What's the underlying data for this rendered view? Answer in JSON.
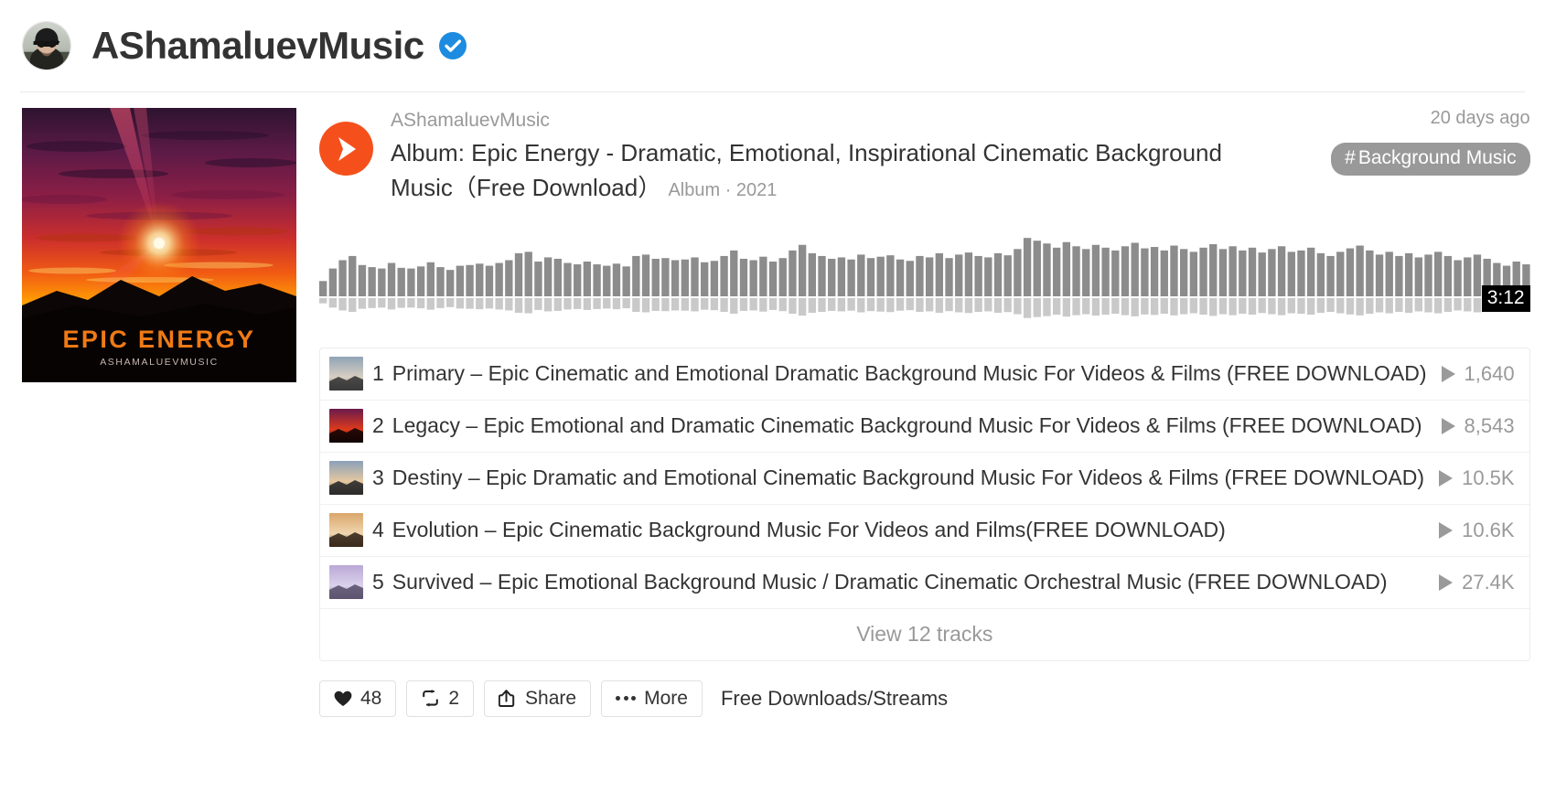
{
  "header": {
    "username": "AShamaluevMusic",
    "verified_icon": "verified-badge-icon",
    "avatar_icon": "user-avatar"
  },
  "artwork": {
    "album_title": "EPIC ENERGY",
    "album_artist": "ASHAMALUEVMUSIC"
  },
  "track": {
    "uploader": "AShamaluevMusic",
    "title": "Album: Epic Energy - Dramatic, Emotional, Inspirational Cinematic Background Music（Free Download）",
    "subtitle": "Album · 2021",
    "posted": "20 days ago",
    "tag": "Background Music",
    "tag_hash": "#",
    "duration": "3:12",
    "play_icon": "play-icon"
  },
  "tracklist": {
    "view_all_label": "View 12 tracks",
    "tracks": [
      {
        "index": "1",
        "title": "Primary – Epic Cinematic and Emotional Dramatic Background Music For Videos & Films (FREE DOWNLOAD)",
        "plays": "1,640"
      },
      {
        "index": "2",
        "title": "Legacy – Epic Emotional and Dramatic Cinematic Background Music For Videos & Films (FREE DOWNLOAD)",
        "plays": "8,543"
      },
      {
        "index": "3",
        "title": "Destiny – Epic Dramatic and Emotional Cinematic Background Music For Videos & Films (FREE DOWNLOAD)",
        "plays": "10.5K"
      },
      {
        "index": "4",
        "title": "Evolution – Epic Cinematic Background Music For Videos and Films(FREE DOWNLOAD)",
        "plays": "10.6K"
      },
      {
        "index": "5",
        "title": "Survived – Epic Emotional Background Music / Dramatic Cinematic Orchestral Music (FREE DOWNLOAD)",
        "plays": "27.4K"
      }
    ]
  },
  "actions": {
    "like": {
      "label": "48",
      "icon": "heart-icon"
    },
    "repost": {
      "label": "2",
      "icon": "repost-icon"
    },
    "share": {
      "label": "Share",
      "icon": "share-icon"
    },
    "more": {
      "label": "More",
      "icon": "ellipsis-icon"
    },
    "download_note": "Free Downloads/Streams"
  },
  "colors": {
    "accent": "#f5501c",
    "verified_blue": "#1d8ce0",
    "text": "#333333",
    "muted": "#999999",
    "tag_bg": "#999999",
    "duration_bg": "#000000"
  },
  "waveform": {
    "upper": [
      22,
      40,
      52,
      58,
      45,
      42,
      40,
      48,
      41,
      40,
      43,
      49,
      42,
      38,
      44,
      45,
      47,
      44,
      48,
      52,
      62,
      64,
      50,
      56,
      54,
      48,
      46,
      50,
      46,
      44,
      47,
      43,
      58,
      60,
      54,
      55,
      52,
      53,
      56,
      49,
      51,
      58,
      66,
      54,
      52,
      57,
      50,
      55,
      66,
      74,
      62,
      58,
      54,
      56,
      53,
      60,
      55,
      57,
      59,
      53,
      51,
      58,
      56,
      62,
      55,
      60,
      63,
      58,
      56,
      62,
      59,
      68,
      84,
      80,
      76,
      70,
      78,
      72,
      68,
      74,
      70,
      66,
      72,
      77,
      69,
      71,
      66,
      73,
      68,
      64,
      70,
      75,
      68,
      72,
      66,
      70,
      63,
      68,
      72,
      64,
      66,
      70,
      62,
      58,
      64,
      69,
      73,
      66,
      60,
      64,
      58,
      62,
      56,
      60,
      64,
      58,
      52,
      56,
      60,
      54,
      48,
      44,
      50,
      46
    ],
    "lower_ratio": 0.34
  }
}
